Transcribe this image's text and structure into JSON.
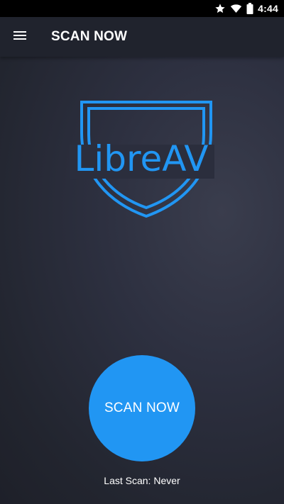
{
  "status_bar": {
    "time": "4:44",
    "icons": [
      "star-icon",
      "wifi-icon",
      "battery-icon"
    ]
  },
  "app_bar": {
    "menu_icon": "menu-icon",
    "title": "SCAN NOW"
  },
  "logo": {
    "text": "LibreAV",
    "color": "#2196f3"
  },
  "scan_button": {
    "label": "SCAN NOW",
    "color": "#2196f3"
  },
  "last_scan": {
    "text": "Last Scan: Never"
  }
}
